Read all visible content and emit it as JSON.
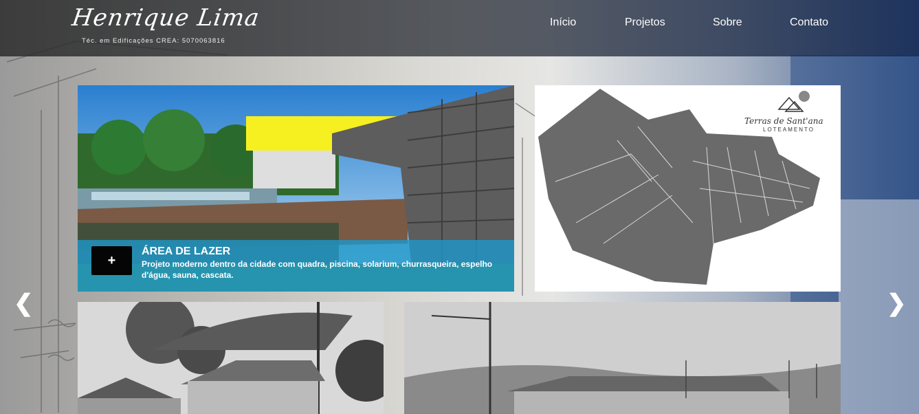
{
  "header": {
    "logo_name": "Henrique Lima",
    "logo_subtitle": "Téc. em Edificações   CREA: 5070063816"
  },
  "nav": {
    "items": [
      {
        "label": "Início"
      },
      {
        "label": "Projetos"
      },
      {
        "label": "Sobre"
      },
      {
        "label": "Contato"
      }
    ]
  },
  "projects": [
    {
      "title": "ÁREA DE LAZER",
      "description": "Projeto moderno dentro da cidade com quadra, piscina, solarium, churrasqueira, espelho d'água, sauna, cascata.",
      "button_label": "+"
    }
  ],
  "map_tile": {
    "brand": "Terras de Sant'ana",
    "brand_sub": "LOTEAMENTO"
  },
  "carousel": {
    "prev_icon": "chevron-left-icon",
    "next_icon": "chevron-right-icon",
    "prev_glyph": "❮",
    "next_glyph": "❯"
  },
  "colors": {
    "accent": "#1e96c8",
    "header_bg": "#2e3137",
    "button_bg": "#050505"
  }
}
